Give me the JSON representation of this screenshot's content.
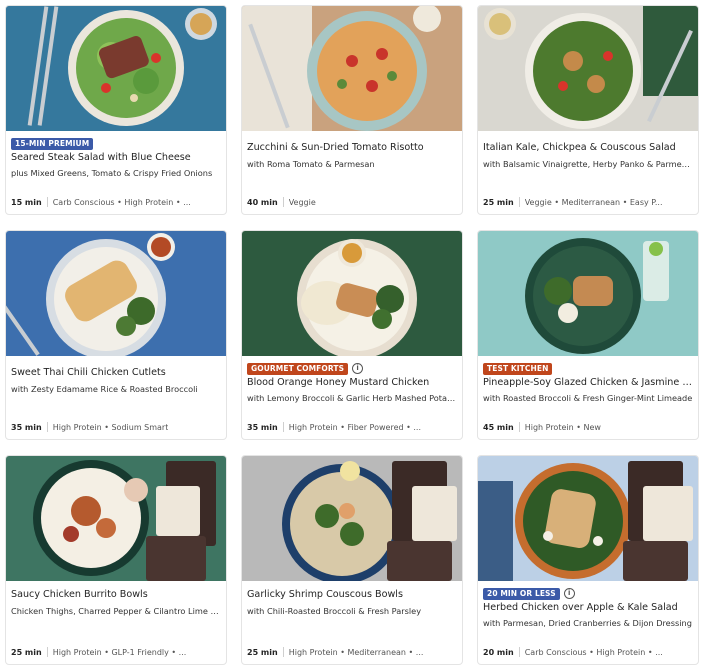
{
  "colors": {
    "badge_premium": "#3b5aa8",
    "badge_gourmet": "#c0461c",
    "badge_test_kitchen": "#c0461c",
    "badge_20min": "#3b5aa8"
  },
  "cards": [
    {
      "badge": "15-MIN PREMIUM",
      "title": "Seared Steak Salad with Blue Cheese",
      "subtitle": "plus Mixed Greens, Tomato & Crispy Fried Onions",
      "time": "15 min",
      "tags": "Carb Conscious • High Protein • ..."
    },
    {
      "title": "Zucchini & Sun-Dried Tomato Risotto",
      "subtitle": "with Roma Tomato & Parmesan",
      "time": "40 min",
      "tags": "Veggie"
    },
    {
      "title": "Italian Kale, Chickpea & Couscous Salad",
      "subtitle": "with Balsamic Vinaigrette, Herby Panko & Parmesan",
      "time": "25 min",
      "tags": "Veggie • Mediterranean • Easy P..."
    },
    {
      "title": "Sweet Thai Chili Chicken Cutlets",
      "subtitle": "with Zesty Edamame Rice & Roasted Broccoli",
      "time": "35 min",
      "tags": "High Protein • Sodium Smart"
    },
    {
      "badge": "GOURMET COMFORTS",
      "title": "Blood Orange Honey Mustard Chicken",
      "subtitle": "with Lemony Broccoli & Garlic Herb Mashed Potatoes",
      "time": "35 min",
      "tags": "High Protein • Fiber Powered • ..."
    },
    {
      "badge": "TEST KITCHEN",
      "title": "Pineapple-Soy Glazed Chicken & Jasmine Ri...",
      "subtitle": "with Roasted Broccoli & Fresh Ginger-Mint Limeade",
      "time": "45 min",
      "tags": "High Protein • New"
    },
    {
      "title": "Saucy Chicken Burrito Bowls",
      "subtitle": "Chicken Thighs, Charred Pepper & Cilantro Lime Rice",
      "time": "25 min",
      "tags": "High Protein • GLP-1 Friendly • ..."
    },
    {
      "title": "Garlicky Shrimp Couscous Bowls",
      "subtitle": "with Chili-Roasted Broccoli & Fresh Parsley",
      "time": "25 min",
      "tags": "High Protein • Mediterranean • ..."
    },
    {
      "badge": "20 MIN OR LESS",
      "title": "Herbed Chicken over Apple & Kale Salad",
      "subtitle": "with Parmesan, Dried Cranberries & Dijon Dressing",
      "time": "20 min",
      "tags": "Carb Conscious • High Protein • ..."
    }
  ]
}
